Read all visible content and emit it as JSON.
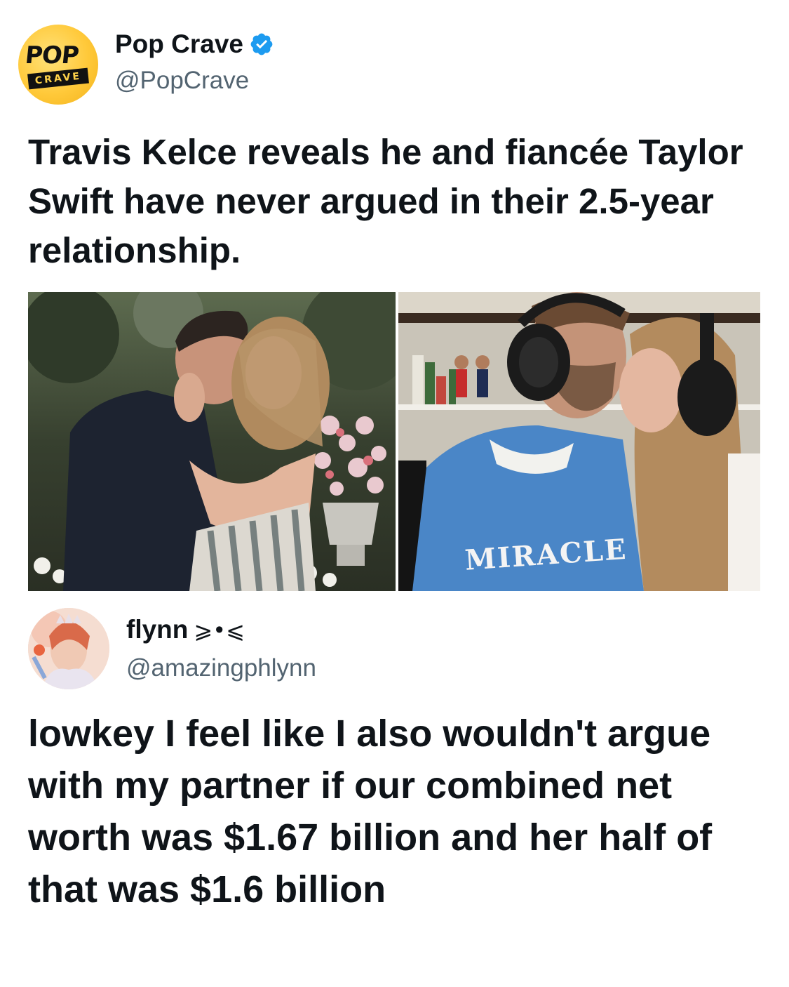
{
  "tweet1": {
    "display_name": "Pop Crave",
    "handle": "@PopCrave",
    "verified": true,
    "avatar": {
      "logo_text_top": "POP",
      "logo_text_bottom": "CRAVE",
      "colors": {
        "background": "#ffc93a",
        "text": "#111111"
      }
    },
    "text": "Travis Kelce reveals he and fiancée Taylor Swift have never argued in their 2.5-year relationship.",
    "images": [
      {
        "name": "couple-garden-photo"
      },
      {
        "name": "couple-podcast-photo",
        "hoodie_text": "MIRACLE"
      }
    ]
  },
  "tweet2": {
    "display_name": "flynn",
    "name_decoration": "⩾•⩽",
    "handle": "@amazingphlynn",
    "text": "lowkey I feel like I also wouldn't argue with my partner if our combined net worth was $1.67 billion and her half of that was $1.6 billion"
  },
  "colors": {
    "verified_blue": "#1d9bf0",
    "handle_gray": "#536471",
    "text": "#0f1419"
  },
  "icons": [
    "verified-badge-icon"
  ]
}
